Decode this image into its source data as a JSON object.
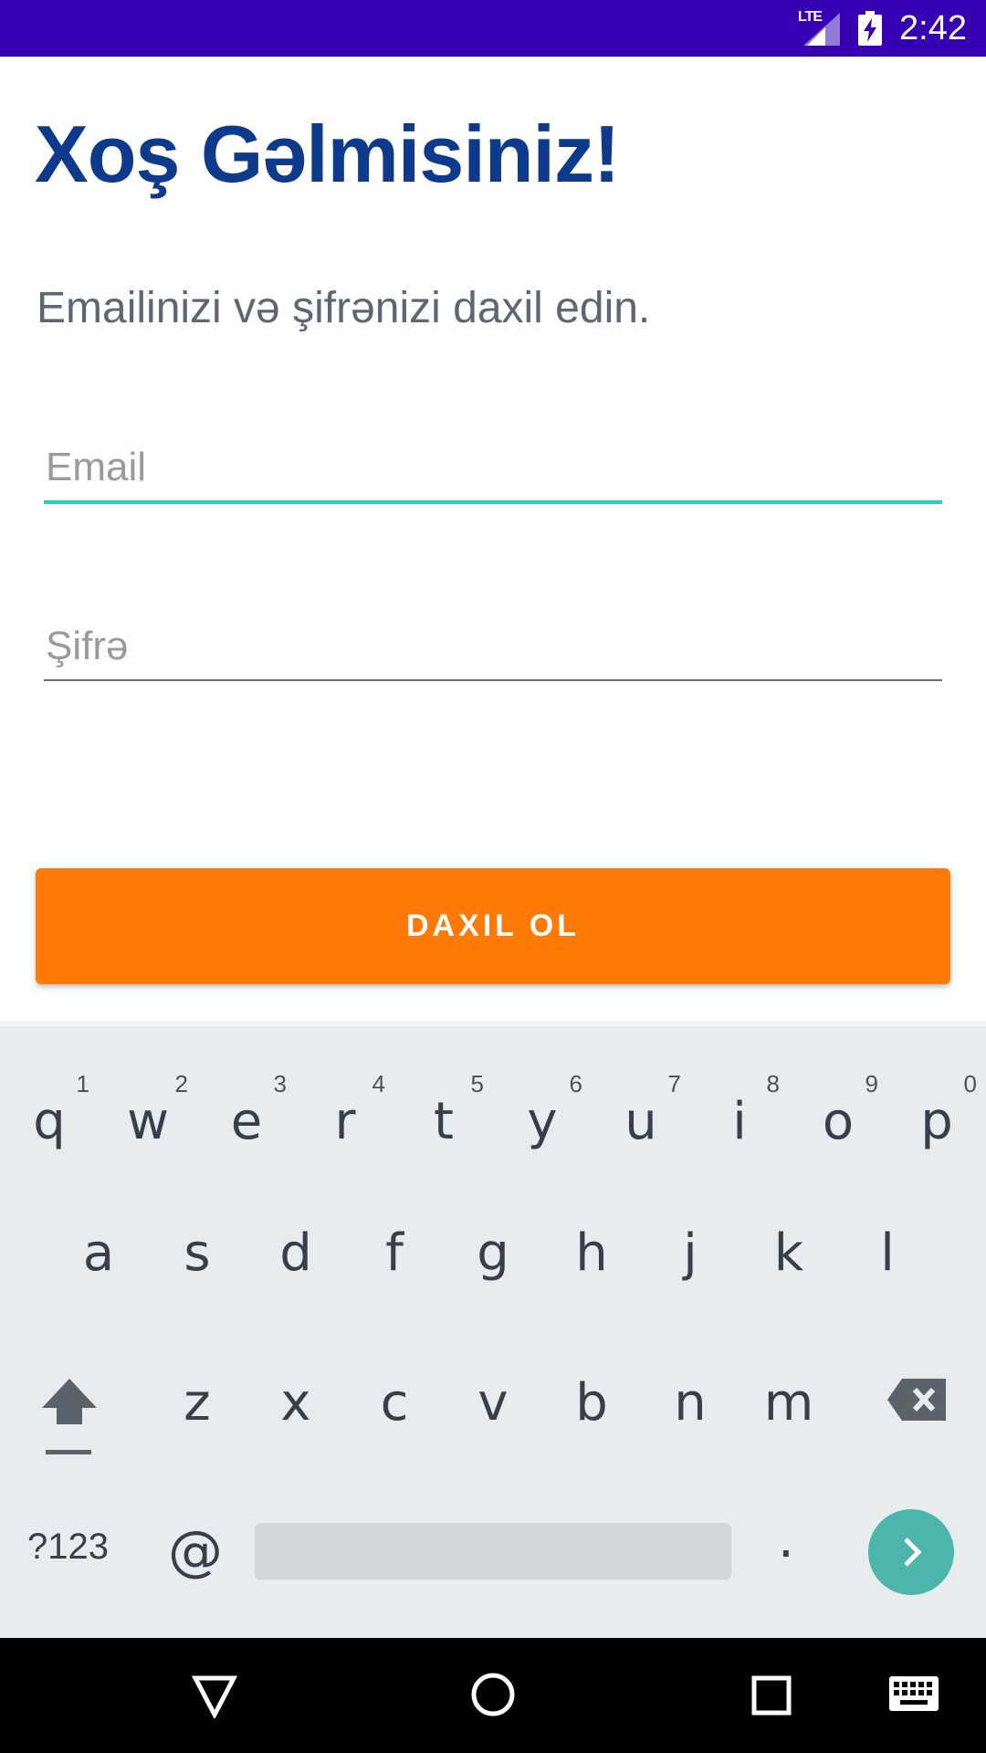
{
  "status_bar": {
    "network": "LTE",
    "time": "2:42",
    "background": "#3700b3"
  },
  "login": {
    "title": "Xoş Gəlmisiniz!",
    "subtitle": "Emailinizi və şifrənizi daxil edin.",
    "email_placeholder": "Email",
    "email_value": "",
    "password_placeholder": "Şifrə",
    "password_value": "",
    "submit_label": "DAXIL OL",
    "title_color": "#0d3a8c",
    "accent_color": "#1fd1c1",
    "button_color": "#ff7a05"
  },
  "keyboard": {
    "row1": [
      {
        "key": "q",
        "hint": "1"
      },
      {
        "key": "w",
        "hint": "2"
      },
      {
        "key": "e",
        "hint": "3"
      },
      {
        "key": "r",
        "hint": "4"
      },
      {
        "key": "t",
        "hint": "5"
      },
      {
        "key": "y",
        "hint": "6"
      },
      {
        "key": "u",
        "hint": "7"
      },
      {
        "key": "i",
        "hint": "8"
      },
      {
        "key": "o",
        "hint": "9"
      },
      {
        "key": "p",
        "hint": "0"
      }
    ],
    "row2": [
      "a",
      "s",
      "d",
      "f",
      "g",
      "h",
      "j",
      "k",
      "l"
    ],
    "row3": [
      "z",
      "x",
      "c",
      "v",
      "b",
      "n",
      "m"
    ],
    "symbols_label": "?123",
    "at_label": "@",
    "period_label": ".",
    "shift_icon": "shift-icon",
    "backspace_icon": "backspace-icon",
    "go_icon": "chevron-right-icon"
  },
  "nav_bar": {
    "back_icon": "back-triangle-icon",
    "home_icon": "home-circle-icon",
    "recents_icon": "recents-square-icon",
    "keyboard_icon": "keyboard-icon"
  }
}
